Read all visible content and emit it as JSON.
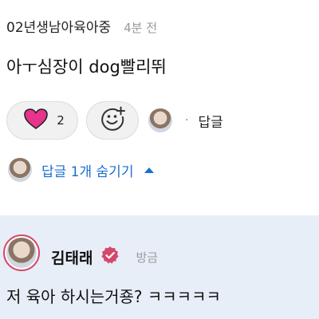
{
  "comment": {
    "author": "02년생남아육아중",
    "time": "4분 전",
    "body": "아ㅜ심장이 dog빨리뛰",
    "like_count": "2",
    "dot": "·",
    "reply_label": "답글"
  },
  "replies_toggle": {
    "label": "답글 1개 숨기기"
  },
  "reply": {
    "author": "김태래",
    "time": "방금",
    "body": "저 육아 하시는거죵? ㅋㅋㅋㅋㅋ"
  },
  "icons": {
    "like": "heart-icon",
    "react": "add-reaction-icon",
    "verified": "verified-badge-icon",
    "collapse": "caret-up-icon"
  },
  "colors": {
    "heart": "#e8348a",
    "link": "#1c6fd1",
    "verified": "#d6476b",
    "reply_background": "#e8eef8"
  }
}
